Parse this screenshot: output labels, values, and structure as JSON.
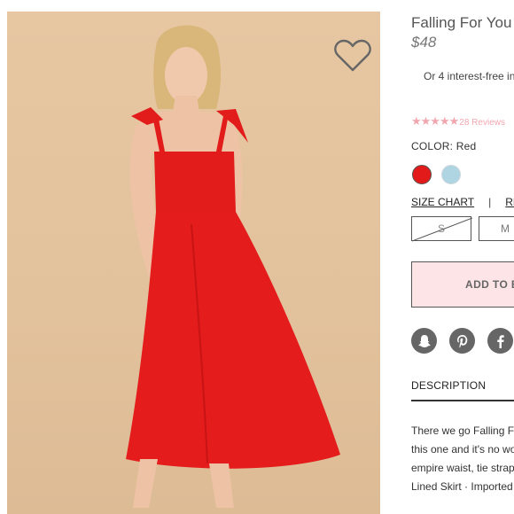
{
  "product": {
    "title": "Falling For You A",
    "price": "$48",
    "installments": "Or 4 interest-free in",
    "rating": {
      "stars": "★★★★★",
      "value": 5,
      "reviews": "28 Reviews"
    },
    "color_label": "COLOR: Red",
    "colors": [
      {
        "name": "red",
        "hex": "#e31a1a",
        "selected": true
      },
      {
        "name": "light-blue",
        "hex": "#afd4e2",
        "selected": false
      }
    ],
    "size_chart_label": "SIZE CHART",
    "separator": "|",
    "returns_label": "RE",
    "sizes": [
      {
        "label": "S",
        "available": false
      },
      {
        "label": "M",
        "available": true
      }
    ],
    "add_to_bag_label": "ADD TO B",
    "social_icons": [
      "snapchat-icon",
      "pinterest-icon",
      "facebook-icon"
    ],
    "description_tab": "DESCRIPTION",
    "description_lines": [
      "There we go Falling F",
      "this one and it's no wo",
      "empire waist, tie strap",
      "Lined Skirt · Imported"
    ]
  },
  "colors": {
    "accent_pink": "#f1a7b0",
    "button_bg": "#fde4e7",
    "icon_gray": "#666666"
  }
}
